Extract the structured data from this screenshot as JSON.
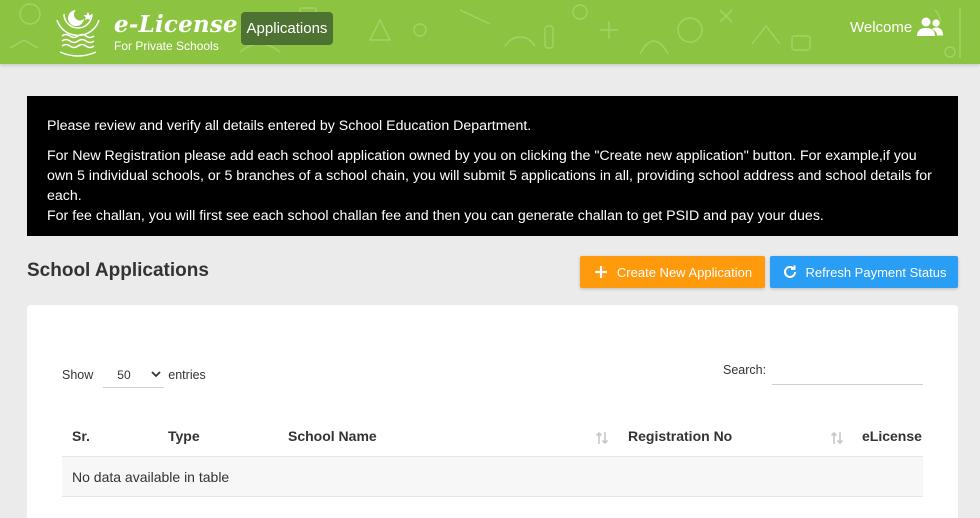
{
  "header": {
    "brand_title": "e-License",
    "brand_subtitle": "For Private Schools",
    "nav_item": "Applications",
    "welcome": "Welcome",
    "bg_color": "#8cc442",
    "active_nav_color": "#4d7231"
  },
  "notice": {
    "line1": "Please review and verify all details entered by School Education Department.",
    "line2": "For New Registration please add each school application owned by you on clicking the \"Create new application\" button. For example,if you own 5 individual schools, or 5 branches of a school chain, you will submit 5 applications in all, providing school address and school details for each.",
    "line3": "For fee challan, you will first see each school challan fee and then you can generate challan to get PSID and pay your dues."
  },
  "section": {
    "title": "School Applications",
    "create_button": "Create New Application",
    "refresh_button": "Refresh Payment Status",
    "create_color": "#ff9a0d",
    "refresh_color": "#2a9df4"
  },
  "table_controls": {
    "show_label": "Show",
    "page_length": "50",
    "entries_label": "entries",
    "search_label": "Search:",
    "search_value": ""
  },
  "table": {
    "columns": [
      "Sr.",
      "Type",
      "School Name",
      "Registration No",
      "eLicense"
    ],
    "empty_message": "No data available in table"
  },
  "icons": {
    "user": "users-icon",
    "create": "plus-icon",
    "refresh": "refresh-icon",
    "sort": "sort-icon",
    "select": "chevron-down-icon"
  }
}
